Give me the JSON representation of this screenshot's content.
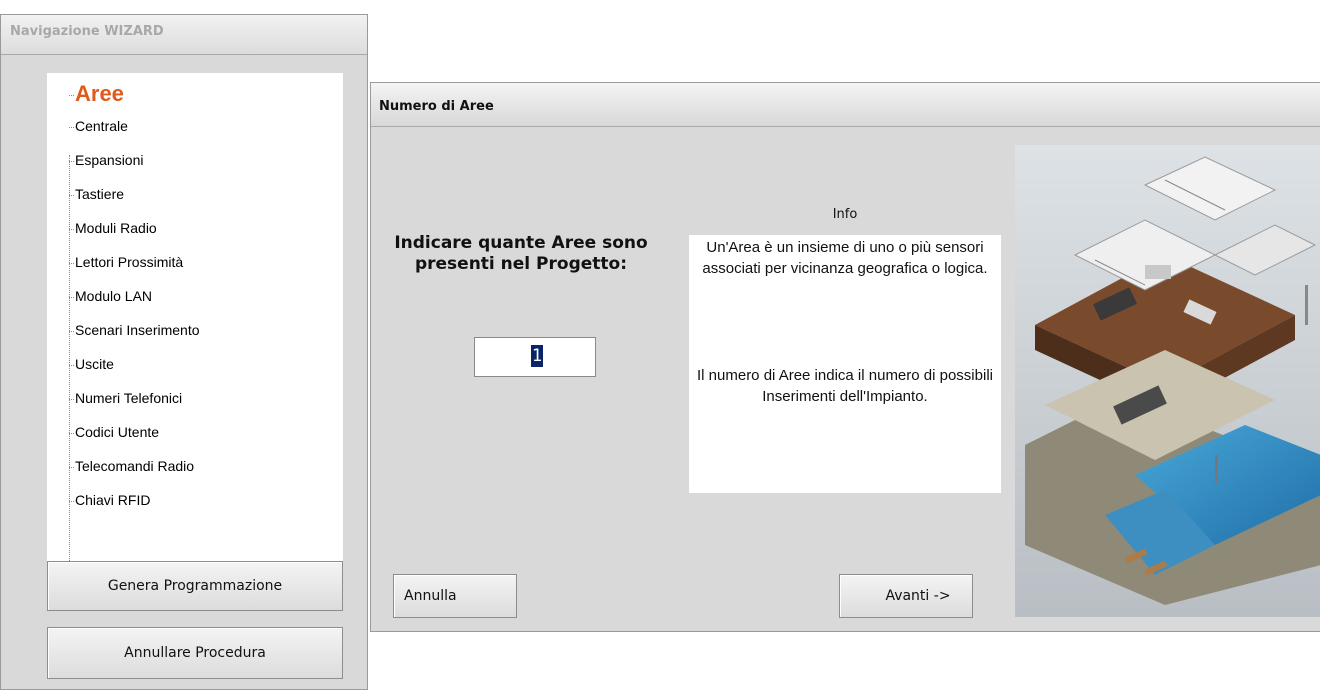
{
  "nav": {
    "title": "Navigazione WIZARD",
    "items": [
      {
        "label": "Aree",
        "active": true
      },
      {
        "label": "Centrale"
      },
      {
        "label": "Espansioni"
      },
      {
        "label": "Tastiere"
      },
      {
        "label": "Moduli Radio"
      },
      {
        "label": "Lettori Prossimità"
      },
      {
        "label": "Modulo LAN"
      },
      {
        "label": "Scenari Inserimento"
      },
      {
        "label": "Uscite"
      },
      {
        "label": "Numeri Telefonici"
      },
      {
        "label": "Codici Utente"
      },
      {
        "label": "Telecomandi Radio"
      },
      {
        "label": "Chiavi RFID"
      }
    ],
    "generate_button": "Genera Programmazione",
    "cancel_procedure_button": "Annullare Procedura"
  },
  "dialog": {
    "title": "Numero di Aree",
    "question": "Indicare quante Aree sono presenti nel Progetto:",
    "area_count_value": "1",
    "info_label": "Info",
    "info_text_1": "Un'Area è un insieme di uno o più sensori associati per vicinanza geografica o logica.",
    "info_text_2": "Il numero di Aree indica il numero di possibili Inserimenti dell'Impianto.",
    "cancel_button": "Annulla",
    "next_button": "Avanti ->"
  },
  "colors": {
    "active_item": "#e05a1a",
    "panel_bg": "#d9d9d9",
    "selection": "#0a246a"
  }
}
